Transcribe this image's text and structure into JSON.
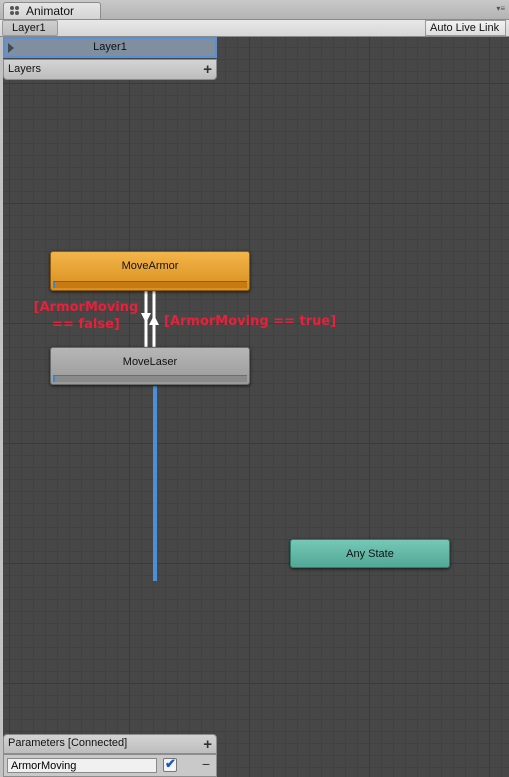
{
  "window": {
    "tab_title": "Animator"
  },
  "toolbar": {
    "breadcrumb": "Layer1",
    "auto_live_link": "Auto Live Link"
  },
  "layers": {
    "header": "Layers",
    "items": [
      {
        "label": "Layer1"
      }
    ],
    "add_symbol": "+"
  },
  "states": {
    "move_armor": {
      "label": "MoveArmor",
      "color": "#e9a434"
    },
    "move_laser": {
      "label": "MoveLaser",
      "color": "#a8a8a8"
    },
    "any_state": {
      "label": "Any State",
      "color": "#63b8a5"
    }
  },
  "annotations": {
    "to_laser": "[ArmorMoving == false]",
    "to_armor": "[ArmorMoving == true]",
    "color": "#e8203a"
  },
  "parameters": {
    "header": "Parameters [Connected]",
    "add_symbol": "+",
    "remove_symbol": "−",
    "items": [
      {
        "name": "ArmorMoving",
        "checked": true,
        "check_symbol": "✔"
      }
    ]
  },
  "colors": {
    "canvas": "#474747",
    "selection": "#5b8fd3",
    "link_highlight": "#4b8fd8"
  }
}
